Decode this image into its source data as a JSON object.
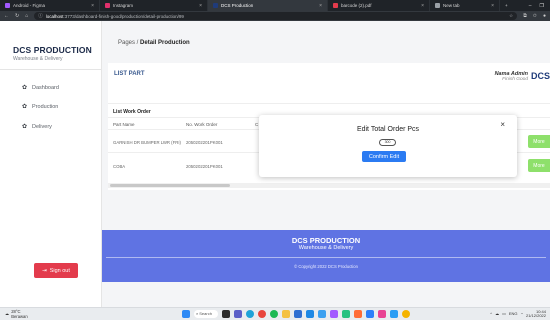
{
  "browser": {
    "tabs": [
      {
        "label": "Android - Figma",
        "color": "#a259ff",
        "active": false
      },
      {
        "label": "Instagram",
        "color": "#e1306c",
        "active": false
      },
      {
        "label": "DCS Production",
        "color": "#1f3b7a",
        "active": true
      },
      {
        "label": "barcode (2).pdf",
        "color": "#e33b4c",
        "active": false
      },
      {
        "label": "New tab",
        "color": "#9aa0a6",
        "active": false
      }
    ],
    "new_tab": "+",
    "url_host": "localhost",
    "url_rest": ":3773/dashboard-finish-good/production/detail-production/99"
  },
  "sidebar": {
    "brand_title": "DCS PRODUCTION",
    "brand_sub": "Warehouse & Delivery",
    "items": [
      {
        "label": "Dashboard",
        "icon": "palette-icon"
      },
      {
        "label": "Production",
        "icon": "palette-icon"
      },
      {
        "label": "Delivery",
        "icon": "palette-icon"
      }
    ],
    "signout": "Sign out"
  },
  "main": {
    "breadcrumb_root": "Pages /",
    "breadcrumb_current": "Detail Production",
    "list_part": "LIST PART",
    "admin_name": "Nama Admin",
    "admin_role": "Finish Good",
    "logo_text": "DCS",
    "table_title": "List Work Order",
    "columns": [
      "Part Name",
      "No. Work Order",
      "C"
    ],
    "rows": [
      {
        "part": "GARNISH DR BUMPER LWR (FRI)",
        "wo": "2050202201PK001",
        "more": "More"
      },
      {
        "part": "COBA",
        "wo": "2050202201PK001",
        "more": "More"
      }
    ]
  },
  "modal": {
    "title": "Edit Total Order Pcs",
    "input_value": "300",
    "button": "Confirm Edit",
    "close": "×"
  },
  "footer": {
    "title": "DCS PRODUCTION",
    "sub": "Warehouse & Delivery",
    "copyright": "© Copyright 2022 DCS Production"
  },
  "taskbar": {
    "temp": "28°C",
    "condition": "Berawan",
    "search": "Search",
    "lang": "ENG",
    "time": "10:44",
    "date": "21/12/2022"
  }
}
